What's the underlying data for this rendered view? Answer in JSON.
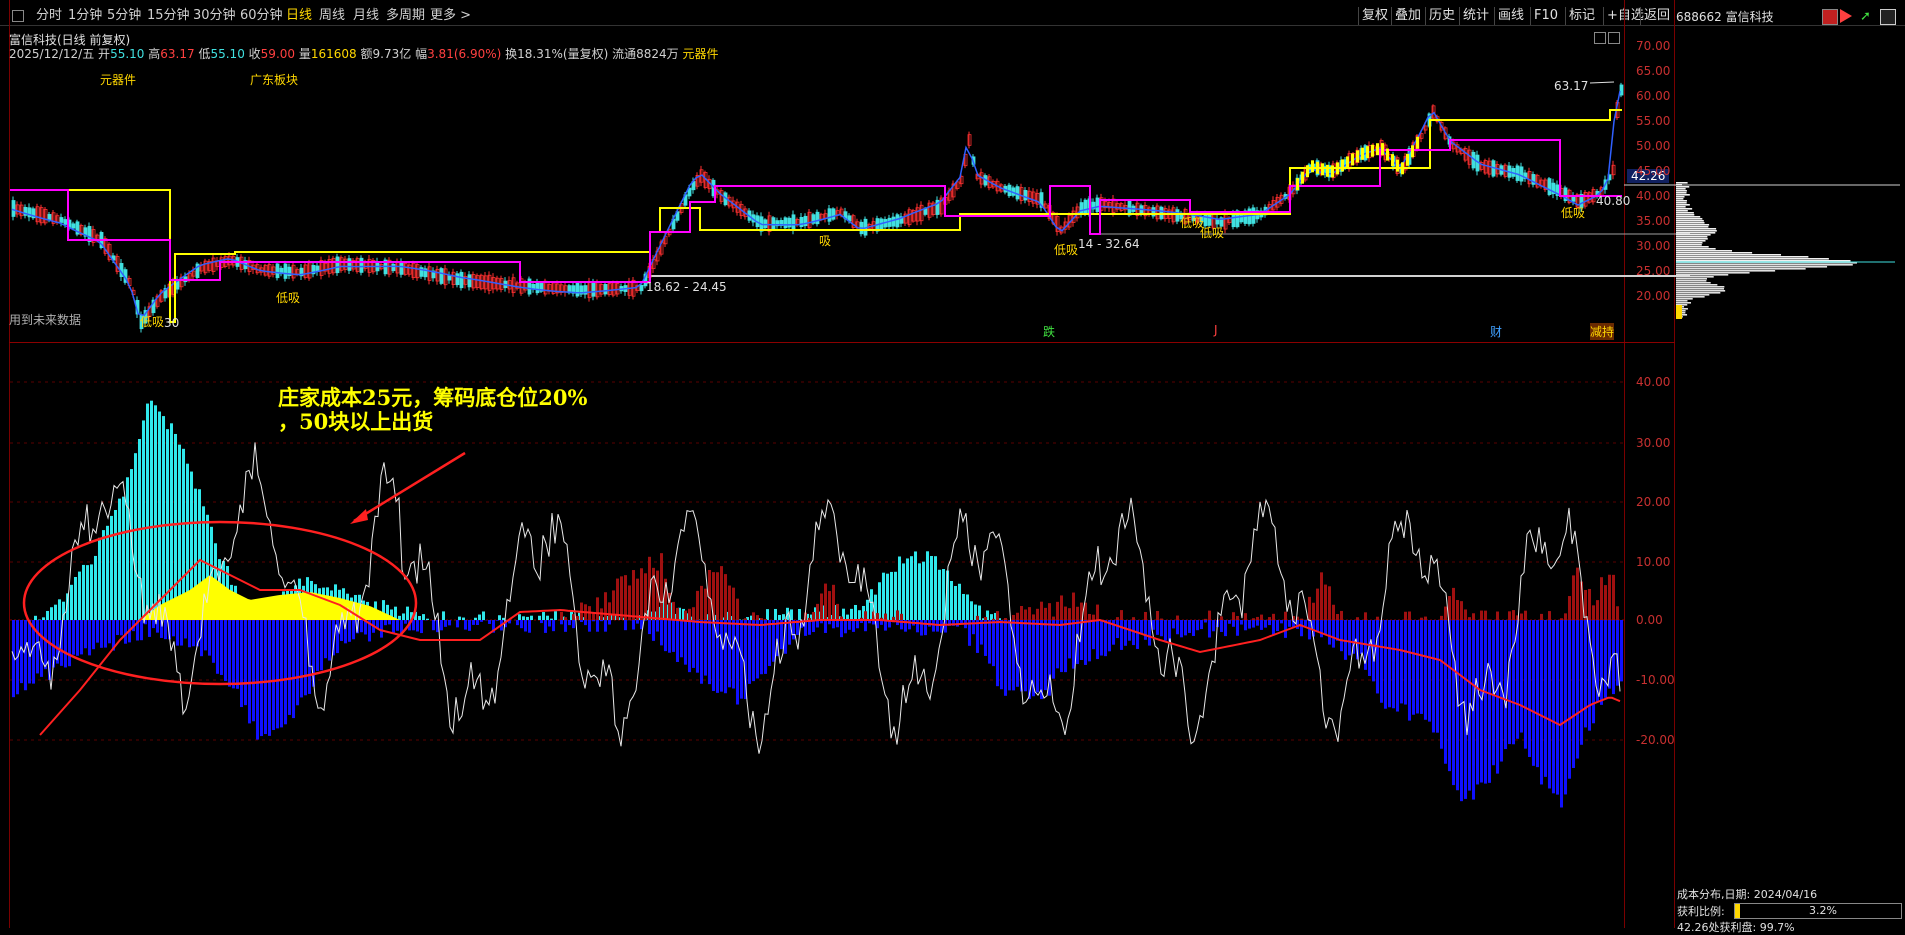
{
  "toolbar": {
    "timeframes": [
      "分时",
      "1分钟",
      "5分钟",
      "15分钟",
      "30分钟",
      "60分钟",
      "日线",
      "周线",
      "月线",
      "多周期",
      "更多 >"
    ],
    "active_index": 6,
    "right_buttons": [
      "复权",
      "叠加",
      "历史",
      "统计",
      "画线",
      "F10",
      "标记",
      "+自选",
      "返回"
    ],
    "stock_code_name": "688662 富信科技"
  },
  "header": {
    "title": "富信科技(日线 前复权)",
    "date": "2025/12/12/五",
    "open_label": "开",
    "open": "55.10",
    "high_label": "高",
    "high": "63.17",
    "low_label": "低",
    "low": "55.10",
    "close_label": "收",
    "close": "59.00",
    "volume_label": "量",
    "volume": "161608",
    "amount_label": "额",
    "amount": "9.73亿",
    "change_label": "幅",
    "change": "3.81(6.90%)",
    "turnover_label": "换",
    "turnover": "18.31%(量复权)",
    "float_label": "流通",
    "float": "8824万",
    "sector": "元器件"
  },
  "main_chart": {
    "tags": [
      "元器件",
      "广东板块"
    ],
    "future_data_note": "用到未来数据",
    "high_price_label": "63.17",
    "current_price_box": "42.26",
    "right_low_label": "40.80",
    "range_label_left": "18.62 - 24.45",
    "range_label_mid": "14 - 32.64",
    "low_label_left": "30",
    "signal_labels": [
      "低吸",
      "低吸",
      "低吸",
      "低吸",
      "吸",
      "低吸",
      "低吸"
    ],
    "event_marks": [
      "跌",
      "J",
      "财",
      "减持"
    ],
    "price_ticks": [
      "70.00",
      "65.00",
      "60.00",
      "55.00",
      "50.00",
      "45.00",
      "40.00",
      "35.00",
      "30.00",
      "25.00",
      "20.00"
    ],
    "colors": {
      "up": "#ff3030",
      "down": "#40e0e0",
      "ma_yellow": "#ffff00",
      "ma_magenta": "#ff00ff",
      "ma_blue": "#3060ff"
    }
  },
  "indicator": {
    "ticks": [
      "40.00",
      "30.00",
      "20.00",
      "10.00",
      "0.00",
      "-10.00",
      "-20.00"
    ],
    "annotation_line1": "庄家成本25元，筹码底仓位20%",
    "annotation_line2": "，50块以上出货",
    "colors": {
      "cyan": "#30e8ec",
      "yellow": "#ffff00",
      "blue": "#1010ff",
      "darkred": "#a01010",
      "white": "#e8e8e8",
      "red": "#ff2020"
    }
  },
  "chip_panel": {
    "title": "成本分布,日期: 2024/04/16",
    "profit_label": "获利比例:",
    "profit_value": "3.2%",
    "profit_fraction": 0.032,
    "bottom_text": "42.26处获利盘: 99.7%"
  }
}
